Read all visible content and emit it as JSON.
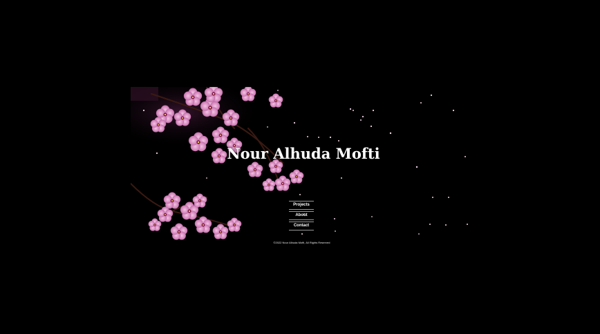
{
  "site": {
    "title": "Nour Alhuda Mofti"
  },
  "nav": {
    "items": [
      {
        "label": "Projects"
      },
      {
        "label": "About"
      },
      {
        "label": "Contact"
      }
    ]
  },
  "footer": {
    "copyright": "©2022 Nour Alhuda Mofti, All Rights Reserved"
  },
  "theme": {
    "background": "#000000",
    "blossom_color": "#d58fc0",
    "blossom_center": "#7a1440",
    "text_color": "#ffffff"
  },
  "image": {
    "subject": "cherry-blossom-branches"
  }
}
